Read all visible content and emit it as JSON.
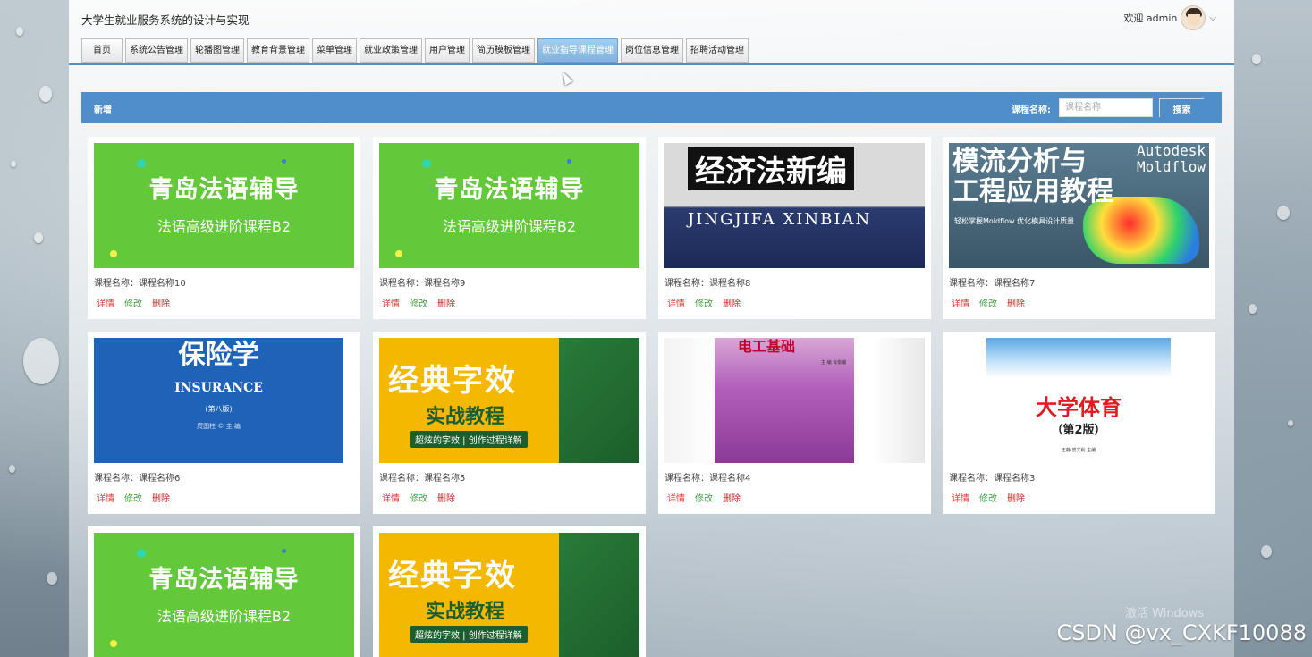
{
  "header": {
    "site_title": "大学生就业服务系统的设计与实现",
    "welcome": "欢迎 admin"
  },
  "nav": [
    {
      "label": "首页",
      "active": false
    },
    {
      "label": "系统公告管理",
      "active": false
    },
    {
      "label": "轮播图管理",
      "active": false
    },
    {
      "label": "教育背景管理",
      "active": false
    },
    {
      "label": "菜单管理",
      "active": false
    },
    {
      "label": "就业政策管理",
      "active": false
    },
    {
      "label": "用户管理",
      "active": false
    },
    {
      "label": "简历模板管理",
      "active": false
    },
    {
      "label": "就业指导课程管理",
      "active": true
    },
    {
      "label": "岗位信息管理",
      "active": false
    },
    {
      "label": "招聘活动管理",
      "active": false
    }
  ],
  "toolbar": {
    "add_label": "新增",
    "search_label": "课程名称:",
    "search_placeholder": "课程名称",
    "search_value": "",
    "search_button": "搜索"
  },
  "card_actions": {
    "detail": "详情",
    "edit": "修改",
    "delete": "删除"
  },
  "cards": [
    {
      "name": "课程名称：课程名称10",
      "image": "green",
      "image_lines": [
        "青岛法语辅导",
        "法语高级进阶课程B2"
      ]
    },
    {
      "name": "课程名称：课程名称9",
      "image": "green",
      "image_lines": [
        "青岛法语辅导",
        "法语高级进阶课程B2"
      ]
    },
    {
      "name": "课程名称：课程名称8",
      "image": "dark",
      "image_lines": [
        "经济法新编",
        "JINGJIFA XINBIAN"
      ]
    },
    {
      "name": "课程名称：课程名称7",
      "image": "mold",
      "image_lines": [
        "模流分析与",
        "工程应用教程",
        "Autodesk",
        "Moldflow",
        "轻松掌握Moldflow 优化模具设计质量"
      ]
    },
    {
      "name": "课程名称：课程名称6",
      "image": "ins",
      "image_lines": [
        "保险学",
        "INSURANCE",
        "(第八版)",
        "庹国柱 © 主 编"
      ]
    },
    {
      "name": "课程名称：课程名称5",
      "image": "yellow",
      "image_lines": [
        "经典字效",
        "实战教程",
        "超炫的字效 | 创作过程详解"
      ]
    },
    {
      "name": "课程名称：课程名称4",
      "image": "ele",
      "image_lines": [
        "电工基础",
        "主 编 肖俊编"
      ]
    },
    {
      "name": "课程名称：课程名称3",
      "image": "pe",
      "image_lines": [
        "大学体育",
        "（第2版）",
        "王静 曾文利 主编"
      ]
    },
    {
      "name": "",
      "image": "green",
      "image_lines": [
        "青岛法语辅导",
        "法语高级进阶课程B2"
      ]
    },
    {
      "name": "",
      "image": "yellow",
      "image_lines": [
        "经典字效",
        "实战教程",
        "超炫的字效 | 创作过程详解"
      ]
    }
  ],
  "overlay": {
    "windows_watermark": "激活 Windows",
    "csdn_watermark": "CSDN @vx_CXKF10088"
  }
}
